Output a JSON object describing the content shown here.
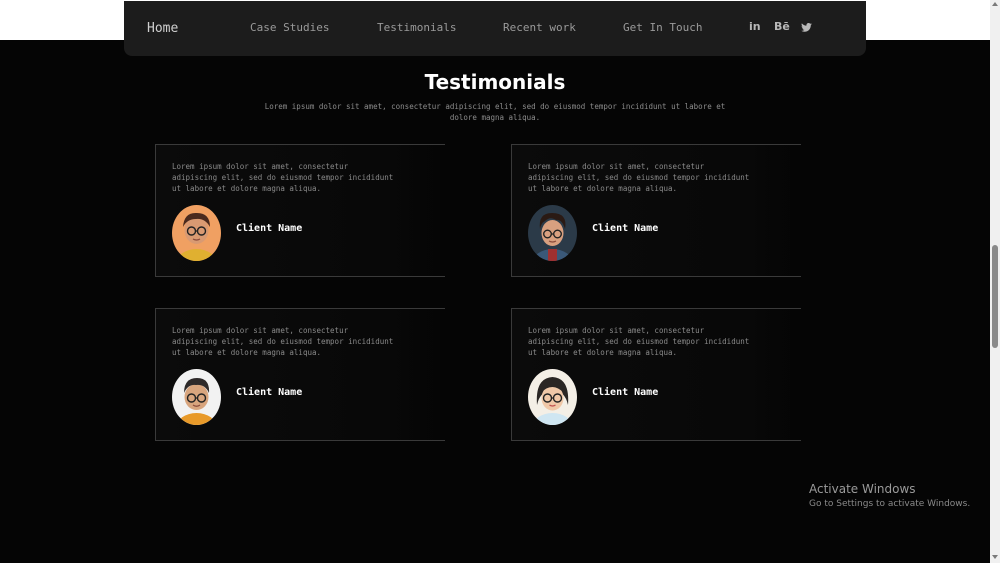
{
  "nav": {
    "home": "Home",
    "case_studies": "Case Studies",
    "testimonials": "Testimonials",
    "recent_work": "Recent work",
    "get_in_touch": "Get In Touch",
    "social": {
      "linkedin": "in",
      "behance": "Bē",
      "twitter": "🐦"
    }
  },
  "section": {
    "title": "Testimonials",
    "subtitle": "Lorem ipsum dolor sit amet, consectetur adipiscing elit, sed do eiusmod tempor incididunt ut labore et dolore magna aliqua."
  },
  "testimonials": [
    {
      "text": "Lorem ipsum dolor sit amet, consectetur adipiscing elit, sed do eiusmod tempor incididunt ut labore et dolore magna aliqua.",
      "name": "Client Name"
    },
    {
      "text": "Lorem ipsum dolor sit amet, consectetur adipiscing elit, sed do eiusmod tempor incididunt ut labore et dolore magna aliqua.",
      "name": "Client Name"
    },
    {
      "text": "Lorem ipsum dolor sit amet, consectetur adipiscing elit, sed do eiusmod tempor incididunt ut labore et dolore magna aliqua.",
      "name": "Client Name"
    },
    {
      "text": "Lorem ipsum dolor sit amet, consectetur adipiscing elit, sed do eiusmod tempor incididunt ut labore et dolore magna aliqua.",
      "name": "Client Name"
    }
  ],
  "windows": {
    "activate_title": "Activate Windows",
    "activate_sub": "Go to Settings to activate Windows."
  },
  "colors": {
    "background": "#050505",
    "navbar": "#1c1c1c",
    "card_border": "#3a3a3a",
    "text_muted": "#8a8a8a",
    "heading": "#ffffff"
  }
}
